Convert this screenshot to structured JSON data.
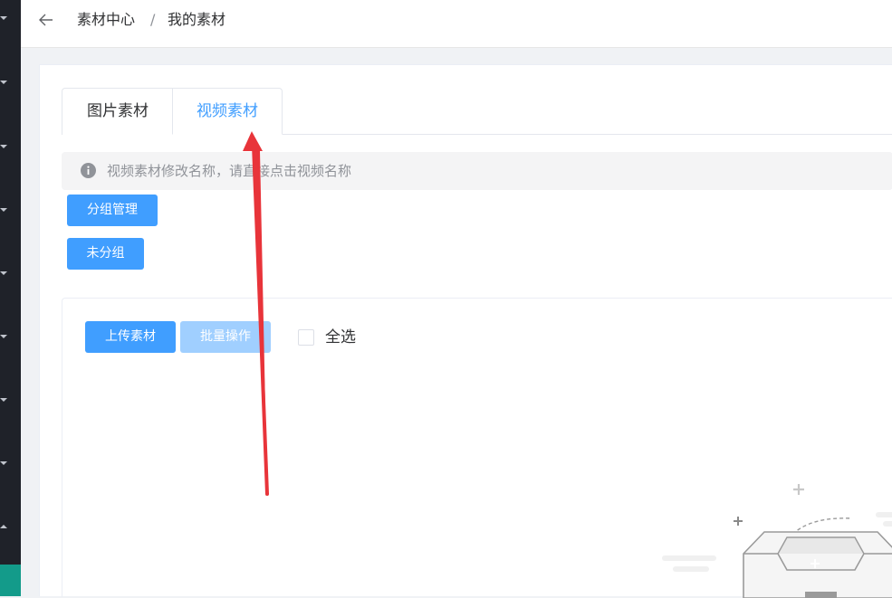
{
  "breadcrumb": {
    "root": "素材中心",
    "separator": "/",
    "current": "我的素材"
  },
  "tabs": [
    {
      "label": "图片素材",
      "active": false
    },
    {
      "label": "视频素材",
      "active": true
    }
  ],
  "alert": {
    "text": "视频素材修改名称，请直接点击视频名称"
  },
  "groups": {
    "manage_label": "分组管理",
    "ungrouped_label": "未分组"
  },
  "toolbar": {
    "upload_label": "上传素材",
    "batch_label": "批量操作",
    "select_all_label": "全选"
  },
  "colors": {
    "primary": "#409eff",
    "primary_disabled": "#a0cfff",
    "sidebar_bg": "#1f2229",
    "sidebar_active": "#139b8a",
    "annotation_arrow": "#e8343a"
  },
  "icons": {
    "back": "arrow-left-icon",
    "info": "info-circle-icon",
    "empty": "empty-box-illustration"
  }
}
